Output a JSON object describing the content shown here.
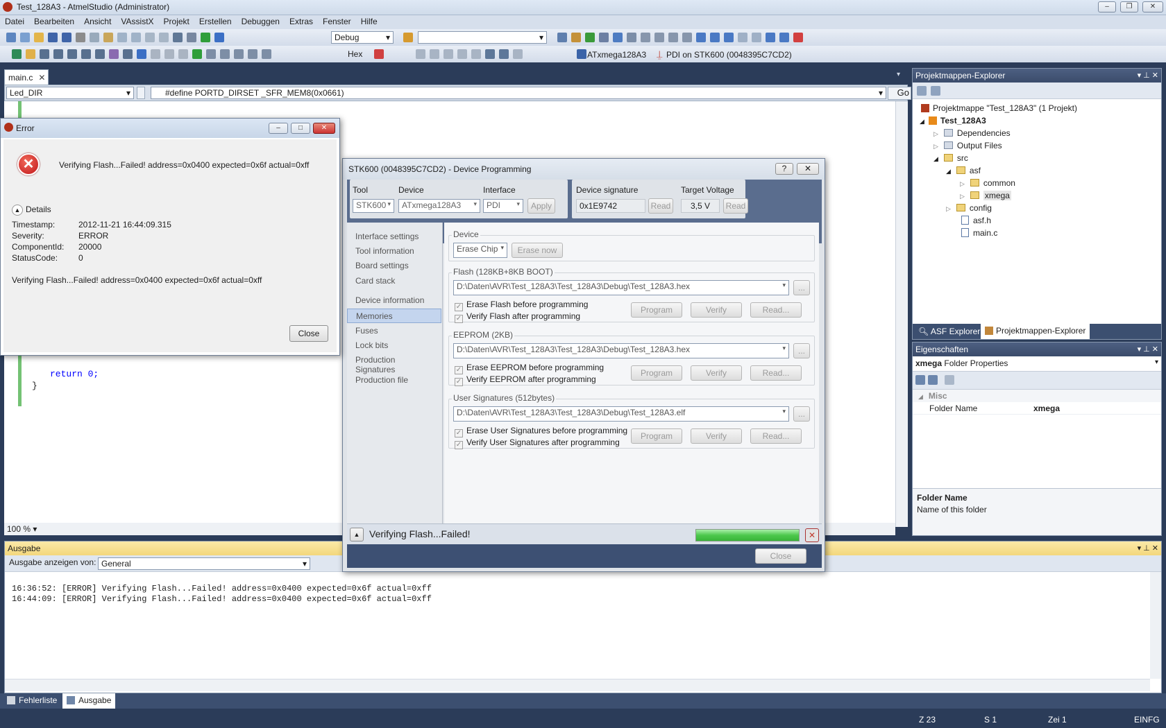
{
  "window": {
    "title": "Test_128A3 - AtmelStudio (Administrator)"
  },
  "menu": [
    "Datei",
    "Bearbeiten",
    "Ansicht",
    "VAssistX",
    "Projekt",
    "Erstellen",
    "Debuggen",
    "Extras",
    "Fenster",
    "Hilfe"
  ],
  "toolbar": {
    "config": "Debug",
    "hex_label": "Hex",
    "device": "ATxmega128A3",
    "tool": "PDI on STK600 (0048395C7CD2)"
  },
  "editor": {
    "tab": "main.c",
    "scope": "Led_DIR",
    "define_text": "#define PORTD_DIRSET _SFR_MEM8(0x0661)",
    "go": "Go",
    "code_return": "return 0;",
    "code_brace": "}",
    "zoom": "100 %"
  },
  "error_dialog": {
    "title": "Error",
    "message": "Verifying Flash...Failed! address=0x0400 expected=0x6f actual=0xff",
    "details_label": "Details",
    "fields": [
      {
        "k": "Timestamp:",
        "v": "2012-11-21 16:44:09.315"
      },
      {
        "k": "Severity:",
        "v": "ERROR"
      },
      {
        "k": "ComponentId:",
        "v": "20000"
      },
      {
        "k": "StatusCode:",
        "v": "0"
      }
    ],
    "detail_message": "Verifying Flash...Failed! address=0x0400 expected=0x6f actual=0xff",
    "close": "Close"
  },
  "prog_dialog": {
    "title": "STK600 (0048395C7CD2) - Device Programming",
    "tool_label": "Tool",
    "tool": "STK600",
    "device_label": "Device",
    "device": "ATxmega128A3",
    "interface_label": "Interface",
    "interface": "PDI",
    "apply": "Apply",
    "sig_label": "Device signature",
    "sig": "0x1E9742",
    "read": "Read",
    "volt_label": "Target Voltage",
    "volt": "3,5 V",
    "nav": [
      "Interface settings",
      "Tool information",
      "Board settings",
      "Card stack",
      "Device information",
      "Memories",
      "Fuses",
      "Lock bits",
      "Production Signatures",
      "Production file"
    ],
    "device_group": "Device",
    "erase_chip": "Erase Chip",
    "erase_now": "Erase now",
    "flash": {
      "label": "Flash (128KB+8KB BOOT)",
      "path": "D:\\Daten\\AVR\\Test_128A3\\Test_128A3\\Debug\\Test_128A3.hex",
      "chk1": "Erase Flash before programming",
      "chk2": "Verify Flash after programming"
    },
    "eeprom": {
      "label": "EEPROM (2KB)",
      "path": "D:\\Daten\\AVR\\Test_128A3\\Test_128A3\\Debug\\Test_128A3.hex",
      "chk1": "Erase EEPROM before programming",
      "chk2": "Verify EEPROM after programming"
    },
    "usersig": {
      "label": "User Signatures (512bytes)",
      "path": "D:\\Daten\\AVR\\Test_128A3\\Test_128A3\\Debug\\Test_128A3.elf",
      "chk1": "Erase User Signatures before programming",
      "chk2": "Verify User Signatures after programming"
    },
    "program": "Program",
    "verify": "Verify",
    "readdots": "Read...",
    "browse": "...",
    "status": "Verifying Flash...Failed!",
    "progress": 1.0,
    "close": "Close"
  },
  "solution": {
    "header": "Projektmappen-Explorer",
    "root": "Projektmappe \"Test_128A3\" (1 Projekt)",
    "project": "Test_128A3",
    "items": [
      {
        "label": "Dependencies"
      },
      {
        "label": "Output Files"
      },
      {
        "label": "src"
      },
      {
        "label": "asf"
      },
      {
        "label": "common"
      },
      {
        "label": "xmega"
      },
      {
        "label": "config"
      },
      {
        "label": "asf.h"
      },
      {
        "label": "main.c"
      }
    ],
    "tab1": "ASF Explorer",
    "tab2": "Projektmappen-Explorer"
  },
  "props": {
    "header": "Eigenschaften",
    "object": "xmega",
    "object_type": "Folder Properties",
    "category": "Misc",
    "name_key": "Folder Name",
    "name_val": "xmega",
    "desc_title": "Folder Name",
    "desc": "Name of this folder"
  },
  "output": {
    "header": "Ausgabe",
    "show_from": "Ausgabe anzeigen von:",
    "source": "General",
    "lines": [
      "16:36:52: [ERROR] Verifying Flash...Failed! address=0x0400 expected=0x6f actual=0xff",
      "16:44:09: [ERROR] Verifying Flash...Failed! address=0x0400 expected=0x6f actual=0xff"
    ],
    "tab1": "Fehlerliste",
    "tab2": "Ausgabe"
  },
  "statusbar": {
    "line": "Z 23",
    "col": "S 1",
    "char": "Zei 1",
    "mode": "EINFG"
  }
}
